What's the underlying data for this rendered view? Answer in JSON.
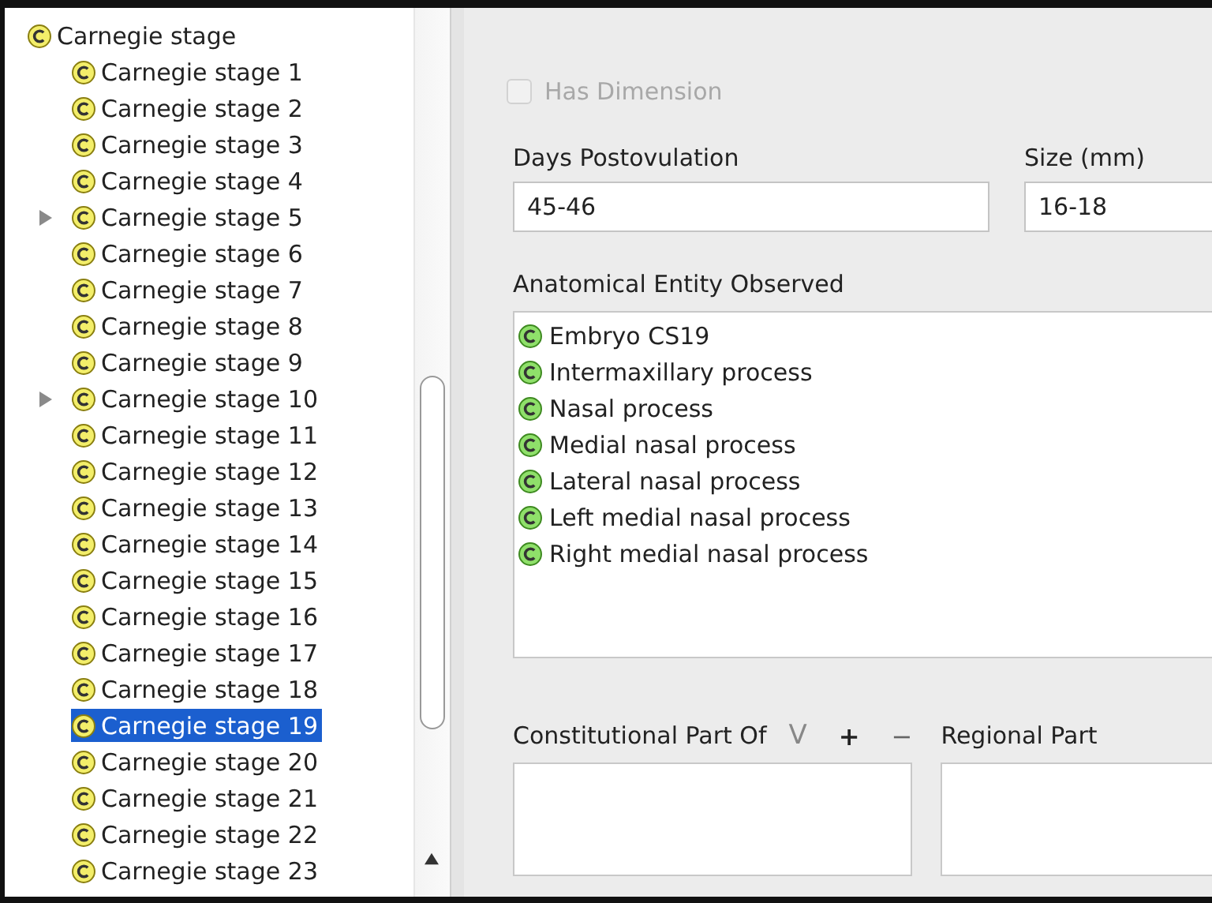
{
  "tree": {
    "label": "Carnegie stage",
    "children": [
      {
        "label": "Carnegie stage 1",
        "expandable": false,
        "selected": false
      },
      {
        "label": "Carnegie stage 2",
        "expandable": false,
        "selected": false
      },
      {
        "label": "Carnegie stage 3",
        "expandable": false,
        "selected": false
      },
      {
        "label": "Carnegie stage 4",
        "expandable": false,
        "selected": false
      },
      {
        "label": "Carnegie stage 5",
        "expandable": true,
        "selected": false
      },
      {
        "label": "Carnegie stage 6",
        "expandable": false,
        "selected": false
      },
      {
        "label": "Carnegie stage 7",
        "expandable": false,
        "selected": false
      },
      {
        "label": "Carnegie stage 8",
        "expandable": false,
        "selected": false
      },
      {
        "label": "Carnegie stage 9",
        "expandable": false,
        "selected": false
      },
      {
        "label": "Carnegie stage 10",
        "expandable": true,
        "selected": false
      },
      {
        "label": "Carnegie stage 11",
        "expandable": false,
        "selected": false
      },
      {
        "label": "Carnegie stage 12",
        "expandable": false,
        "selected": false
      },
      {
        "label": "Carnegie stage 13",
        "expandable": false,
        "selected": false
      },
      {
        "label": "Carnegie stage 14",
        "expandable": false,
        "selected": false
      },
      {
        "label": "Carnegie stage 15",
        "expandable": false,
        "selected": false
      },
      {
        "label": "Carnegie stage 16",
        "expandable": false,
        "selected": false
      },
      {
        "label": "Carnegie stage 17",
        "expandable": false,
        "selected": false
      },
      {
        "label": "Carnegie stage 18",
        "expandable": false,
        "selected": false
      },
      {
        "label": "Carnegie stage 19",
        "expandable": false,
        "selected": true
      },
      {
        "label": "Carnegie stage 20",
        "expandable": false,
        "selected": false
      },
      {
        "label": "Carnegie stage 21",
        "expandable": false,
        "selected": false
      },
      {
        "label": "Carnegie stage 22",
        "expandable": false,
        "selected": false
      },
      {
        "label": "Carnegie stage 23",
        "expandable": false,
        "selected": false
      }
    ]
  },
  "has_dimension": {
    "label": "Has Dimension",
    "checked": false,
    "disabled": true
  },
  "days_postovulation": {
    "label": "Days Postovulation",
    "value": "45-46"
  },
  "size": {
    "label": "Size (mm)",
    "value": "16-18"
  },
  "anatomical_entity_observed": {
    "label": "Anatomical Entity Observed",
    "items": [
      {
        "label": "Embryo CS19"
      },
      {
        "label": "Intermaxillary process"
      },
      {
        "label": "Nasal process"
      },
      {
        "label": "Medial nasal process"
      },
      {
        "label": "Lateral nasal process"
      },
      {
        "label": "Left medial nasal process"
      },
      {
        "label": "Right medial nasal process"
      }
    ]
  },
  "constitutional_part_of": {
    "label": "Constitutional Part Of",
    "buttons": [
      "V",
      "+",
      "−"
    ]
  },
  "regional_part": {
    "label": "Regional Part"
  }
}
